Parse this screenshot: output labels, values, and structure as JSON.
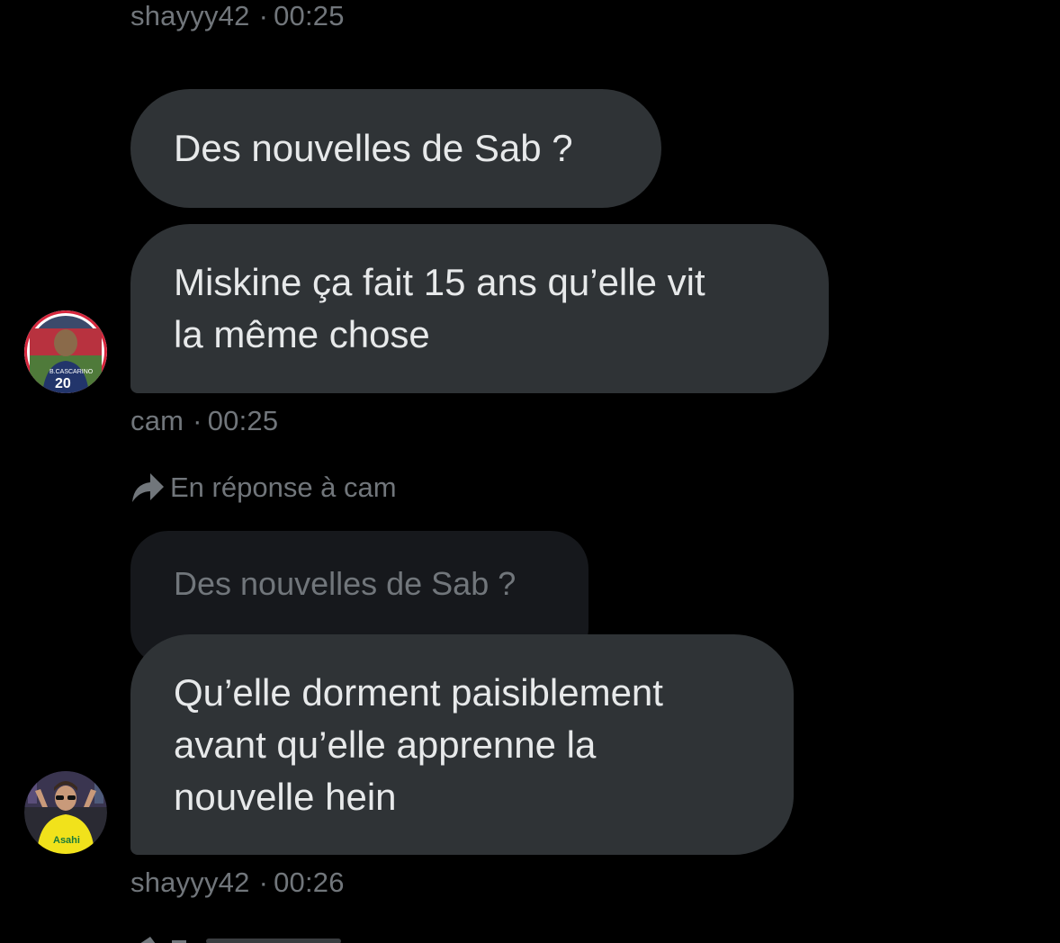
{
  "messages": [
    {
      "meta": {
        "author": "shayyy42",
        "separator": "·",
        "time": "00:25"
      }
    },
    {
      "text": "Des nouvelles de Sab ?"
    },
    {
      "text_line1": "Miskine ça fait 15 ans qu’elle vit",
      "text_line2": "la même chose",
      "meta": {
        "author": "cam",
        "separator": "·",
        "time": "00:25"
      }
    },
    {
      "reply": {
        "label": "En réponse à cam",
        "quoted_text": "Des nouvelles de Sab ?"
      },
      "text_line1": "Qu’elle dorment paisiblement",
      "text_line2": "avant qu’elle apprenne la",
      "text_line3": "nouvelle hein",
      "meta": {
        "author": "shayyy42",
        "separator": "·",
        "time": "00:26"
      }
    }
  ],
  "colors": {
    "background": "#000000",
    "bubble": "#2f3336",
    "quoted_bubble": "#16181c",
    "text": "#e7e9ea",
    "muted": "#71767b"
  },
  "icons": {
    "reply": "reply-arrow-icon"
  }
}
